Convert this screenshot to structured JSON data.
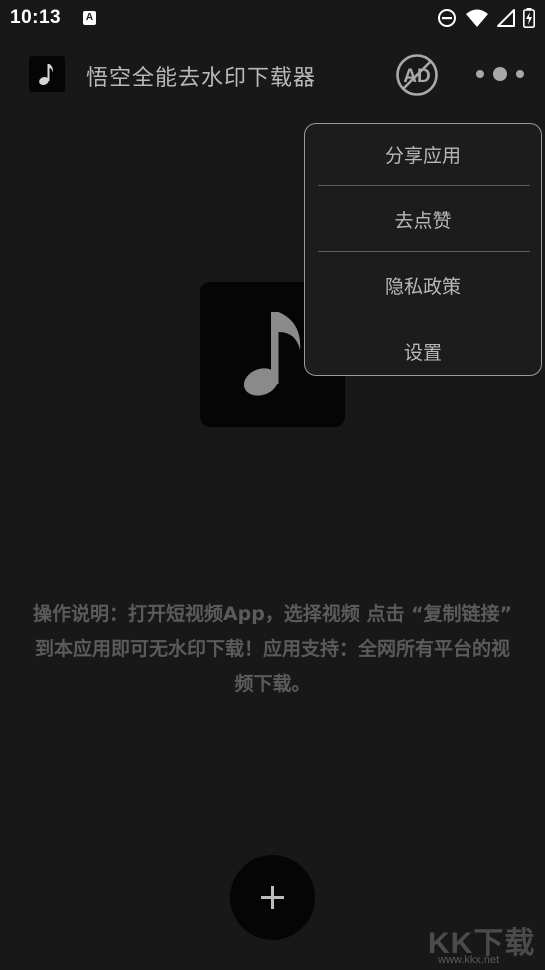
{
  "status_bar": {
    "time": "10:13",
    "notification_badge": "A",
    "icons": [
      "do-not-disturb-icon",
      "wifi-icon",
      "signal-icon",
      "battery-charging-icon"
    ]
  },
  "app_bar": {
    "title": "悟空全能去水印下载器",
    "logo_icon": "music-note-icon",
    "ad_button_label": "AD",
    "more_icon": "more-dots-icon"
  },
  "main": {
    "logo_icon": "music-note-icon",
    "instructions": "操作说明：打开短视频App，选择视频 点击 “复制链接” 到本应用即可无水印下载！应用支持：全网所有平台的视频下载。"
  },
  "popup_menu": {
    "items": [
      {
        "label": "分享应用"
      },
      {
        "label": "去点赞"
      },
      {
        "label": "隐私政策"
      },
      {
        "label": "设置"
      }
    ]
  },
  "fab": {
    "icon": "plus-icon"
  },
  "watermark": {
    "text": "KK下载",
    "url": "www.kkx.net"
  },
  "colors": {
    "background": "#181818",
    "surface": "#050505",
    "menu_border": "#9a9a9a",
    "text_primary": "#b9b9b9",
    "text_muted": "#5b5b5b"
  }
}
